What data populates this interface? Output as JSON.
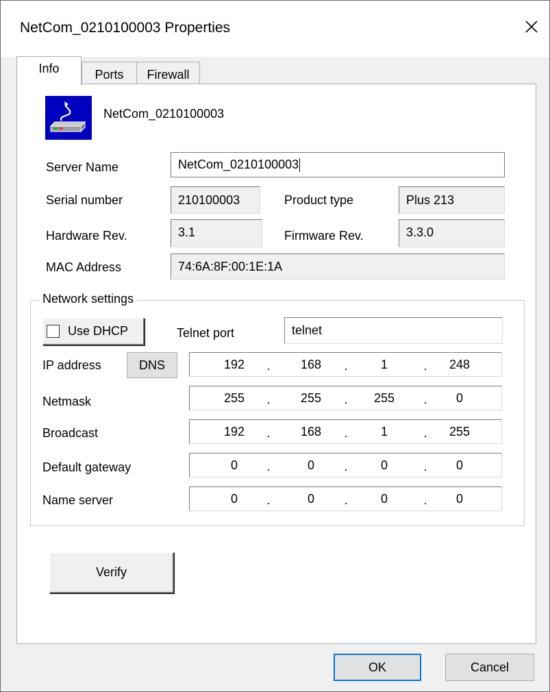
{
  "window": {
    "title": "NetCom_0210100003 Properties",
    "close_icon": "close-icon"
  },
  "tabs": [
    {
      "label": "Info",
      "active": true
    },
    {
      "label": "Ports",
      "active": false
    },
    {
      "label": "Firewall",
      "active": false
    }
  ],
  "info": {
    "device_icon": "network-device-icon",
    "device_name": "NetCom_0210100003",
    "server_name_label": "Server Name",
    "server_name_value": "NetCom_0210100003",
    "serial_label": "Serial number",
    "serial_value": "210100003",
    "product_type_label": "Product type",
    "product_type_value": "Plus 213",
    "hardware_rev_label": "Hardware Rev.",
    "hardware_rev_value": "3.1",
    "firmware_rev_label": "Firmware Rev.",
    "firmware_rev_value": "3.3.0",
    "mac_label": "MAC Address",
    "mac_value": "74:6A:8F:00:1E:1A"
  },
  "network": {
    "group_label": "Network settings",
    "use_dhcp_label": "Use DHCP",
    "use_dhcp_checked": false,
    "telnet_port_label": "Telnet port",
    "telnet_port_value": "telnet",
    "dns_button": "DNS",
    "rows": [
      {
        "label": "IP address",
        "octets": [
          "192",
          "168",
          "1",
          "248"
        ]
      },
      {
        "label": "Netmask",
        "octets": [
          "255",
          "255",
          "255",
          "0"
        ]
      },
      {
        "label": "Broadcast",
        "octets": [
          "192",
          "168",
          "1",
          "255"
        ]
      },
      {
        "label": "Default gateway",
        "octets": [
          "0",
          "0",
          "0",
          "0"
        ]
      },
      {
        "label": "Name server",
        "octets": [
          "0",
          "0",
          "0",
          "0"
        ]
      }
    ]
  },
  "buttons": {
    "verify": "Verify",
    "ok": "OK",
    "cancel": "Cancel"
  },
  "colors": {
    "accent": "#0078d7",
    "icon_bg": "#0000c0"
  }
}
